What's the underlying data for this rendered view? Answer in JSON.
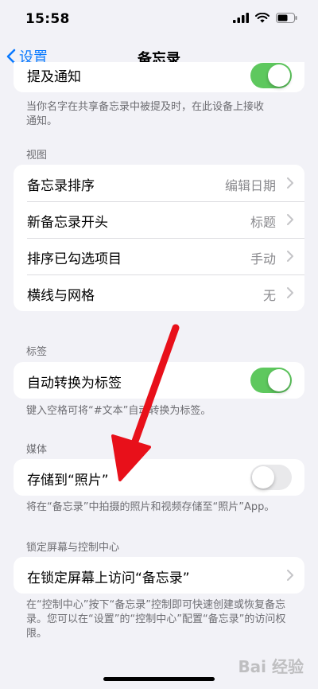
{
  "status": {
    "time": "15:58"
  },
  "nav": {
    "back_label": "设置",
    "title": "备忘录"
  },
  "top_group": {
    "label": "提及通知",
    "toggle_on": true
  },
  "top_footer": "当你名字在共享备忘录中被提及时，在此设备上接收通知。",
  "view": {
    "header": "视图",
    "rows": [
      {
        "label": "备忘录排序",
        "value": "编辑日期"
      },
      {
        "label": "新备忘录开头",
        "value": "标题"
      },
      {
        "label": "排序已勾选项目",
        "value": "手动"
      },
      {
        "label": "横线与网格",
        "value": "无"
      }
    ]
  },
  "tags": {
    "header": "标签",
    "row": {
      "label": "自动转换为标签",
      "toggle_on": true
    },
    "footer": "键入空格可将“#文本”自动转换为标签。"
  },
  "media": {
    "header": "媒体",
    "row": {
      "label": "存储到“照片”",
      "toggle_on": false
    },
    "footer": "将在“备忘录”中拍摄的照片和视频存储至“照片”App。"
  },
  "lock": {
    "header": "锁定屏幕与控制中心",
    "row": {
      "label": "在锁定屏幕上访问“备忘录”"
    },
    "footer": "在“控制中心”按下“备忘录”控制即可快速创建或恢复备忘录。您可以在“设置”的“控制中心”配置“备忘录”的访问权限。"
  },
  "watermark": "Bai 经验",
  "colors": {
    "accent": "#0a7aff",
    "toggle_on": "#5ec85e",
    "arrow": "#e8101a"
  }
}
